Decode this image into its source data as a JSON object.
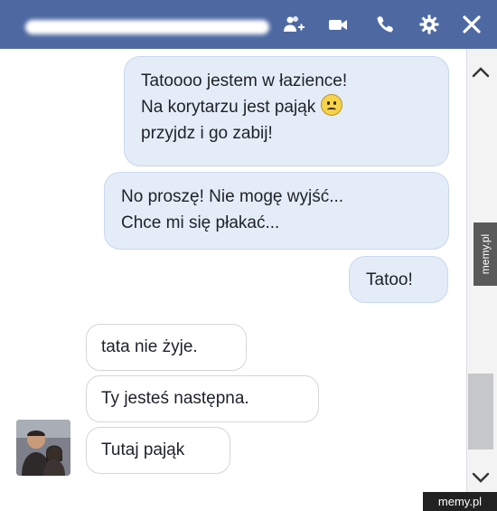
{
  "header": {
    "contact_name": "",
    "icons": [
      "add-friend-icon",
      "video-call-icon",
      "phone-icon",
      "gear-icon",
      "close-icon"
    ],
    "color": "#4e69a2"
  },
  "messages": {
    "out": [
      {
        "lines": [
          "Tatoooo jestem w łazience!",
          "Na korytarzu jest pająk",
          "przyjdz i go zabij!"
        ],
        "emoji": "sad-face-icon"
      },
      {
        "lines": [
          "No proszę! Nie mogę wyjść...",
          "Chce mi się płakać..."
        ]
      },
      {
        "lines": [
          "Tatoo!"
        ]
      }
    ],
    "in": [
      {
        "lines": [
          "tata nie żyje."
        ]
      },
      {
        "lines": [
          "Ty jesteś następna."
        ]
      },
      {
        "lines": [
          "Tutaj pająk"
        ]
      }
    ]
  },
  "watermarks": {
    "side": "memy.pl",
    "bottom": "memy.pl"
  }
}
